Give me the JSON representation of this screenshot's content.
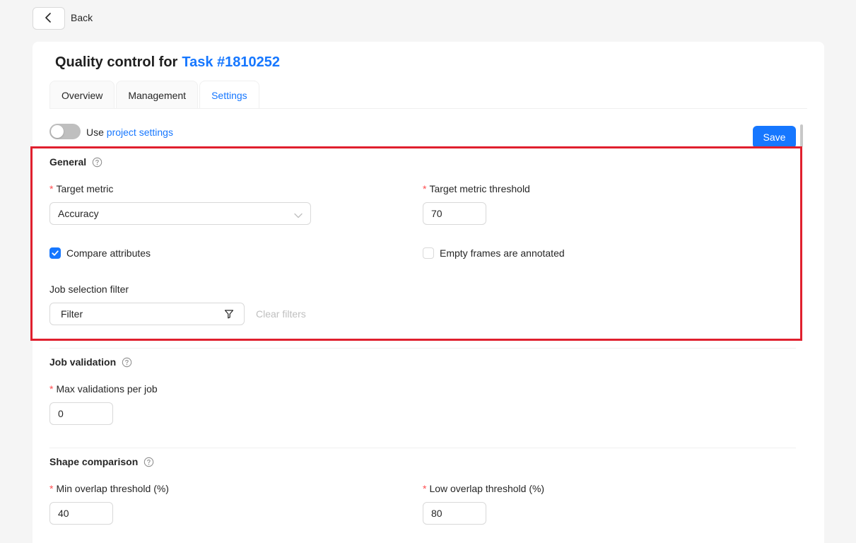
{
  "nav": {
    "back_label": "Back"
  },
  "header": {
    "title_prefix": "Quality control for",
    "task_link": "Task #1810252"
  },
  "tabs": [
    {
      "label": "Overview"
    },
    {
      "label": "Management"
    },
    {
      "label": "Settings"
    }
  ],
  "project_toggle": {
    "prefix": "Use",
    "link_text": "project settings",
    "enabled": false
  },
  "toolbar": {
    "save_label": "Save"
  },
  "general": {
    "title": "General",
    "target_metric": {
      "label": "Target metric",
      "value": "Accuracy"
    },
    "target_threshold": {
      "label": "Target metric threshold",
      "value": "70"
    },
    "compare_attributes": {
      "label": "Compare attributes",
      "checked": true
    },
    "empty_frames": {
      "label": "Empty frames are annotated",
      "checked": false
    },
    "job_filter": {
      "label": "Job selection filter",
      "value": "Filter",
      "clear_label": "Clear filters"
    }
  },
  "job_validation": {
    "title": "Job validation",
    "max_validations": {
      "label": "Max validations per job",
      "value": "0"
    }
  },
  "shape_comparison": {
    "title": "Shape comparison",
    "min_overlap": {
      "label": "Min overlap threshold (%)",
      "value": "40"
    },
    "low_overlap": {
      "label": "Low overlap threshold (%)",
      "value": "80"
    }
  },
  "colors": {
    "accent": "#1677ff",
    "highlight": "#e0202e",
    "required": "#ff4d4f"
  },
  "icons": [
    "chevron-left-icon",
    "help-circle-icon",
    "chevron-down-icon",
    "filter-icon",
    "check-icon"
  ]
}
